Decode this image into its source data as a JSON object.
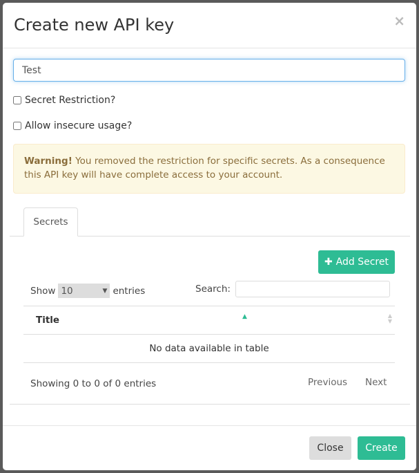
{
  "modal": {
    "title": "Create new API key",
    "close_icon": "×"
  },
  "form": {
    "name_value": "Test",
    "secret_restriction_label": "Secret Restriction?",
    "allow_insecure_label": "Allow insecure usage?"
  },
  "warning": {
    "strong": "Warning!",
    "text": " You removed the restriction for specific secrets. As a consequence this API key will have complete access to your account."
  },
  "tabs": [
    {
      "label": "Secrets",
      "active": true
    }
  ],
  "secrets": {
    "add_button": "Add Secret",
    "show_label": "Show",
    "entries_value": "10",
    "entries_label": "entries",
    "search_label": "Search:",
    "columns": [
      "Title"
    ],
    "empty_text": "No data available in table",
    "info": "Showing 0 to 0 of 0 entries",
    "previous": "Previous",
    "next": "Next"
  },
  "footer": {
    "close": "Close",
    "create": "Create"
  },
  "colors": {
    "accent": "#2ebc94",
    "warning_bg": "#fcf8e3",
    "warning_text": "#8a6d3b"
  }
}
